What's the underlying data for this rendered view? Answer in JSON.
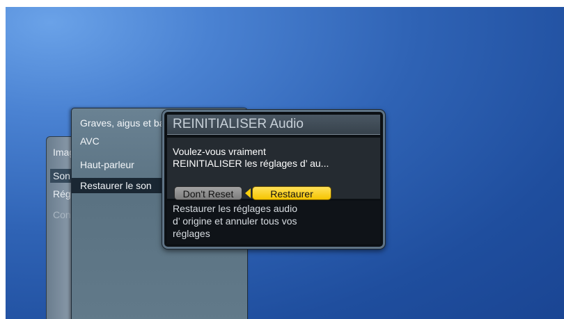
{
  "main_menu": {
    "items": [
      {
        "label": "Image"
      },
      {
        "label": "Son"
      },
      {
        "label": "Réglages"
      },
      {
        "label": "Consommation d'énergie"
      }
    ]
  },
  "sub_menu": {
    "items": [
      {
        "label": "Graves, aigus et balance"
      },
      {
        "label": "AVC"
      },
      {
        "label": "Haut-parleur"
      },
      {
        "label": "Restaurer le son"
      }
    ]
  },
  "dialog": {
    "title": "REINITIALISER Audio",
    "message_line1": "Voulez-vous vraiment",
    "message_line2": "REINITIALISER les réglages d’ au...",
    "buttons": {
      "dont_reset": "Don't Reset",
      "restore": "Restaurer"
    },
    "help_line1": "Restaurer les réglages audio",
    "help_line2": "d’ origine et annuler tous vos",
    "help_line3": "réglages"
  },
  "colors": {
    "background": "#2f63b5",
    "focus": "#f5c400",
    "dialog_border": "#5f7486"
  }
}
